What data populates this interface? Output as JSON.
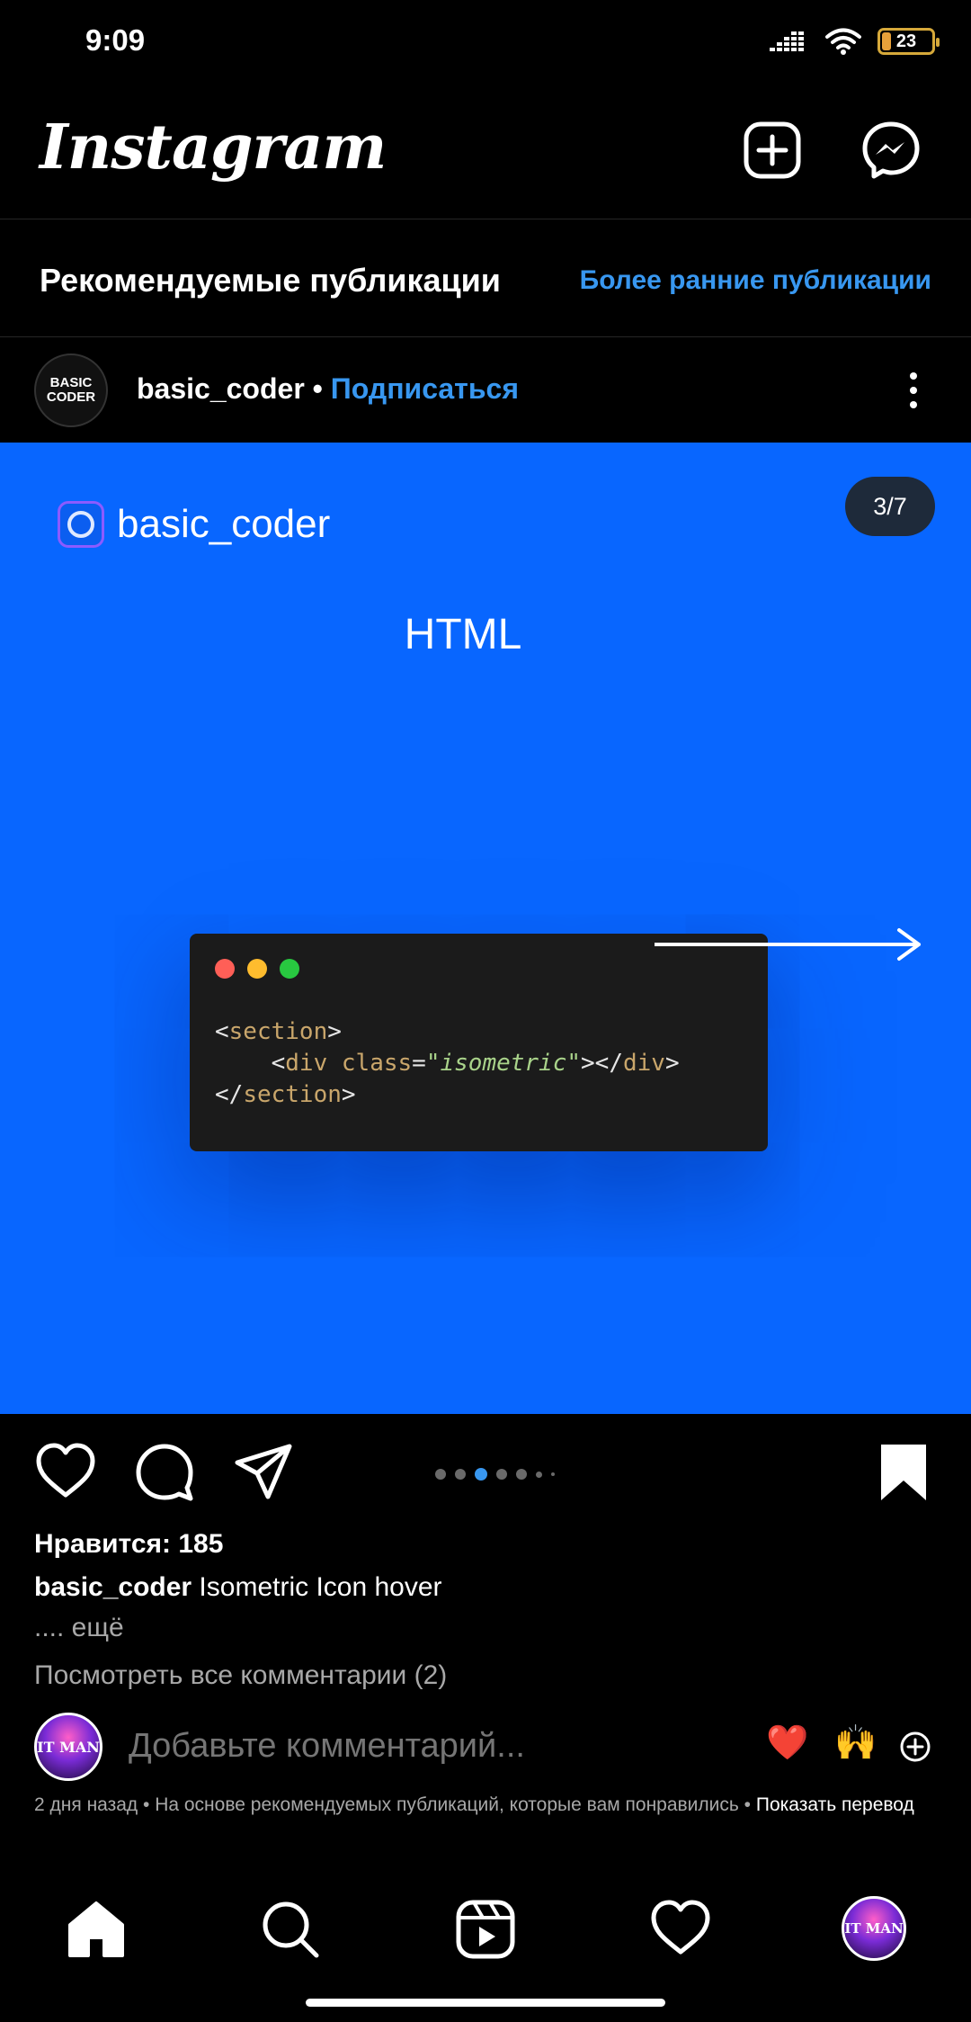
{
  "status_bar": {
    "time": "9:09",
    "battery": "23"
  },
  "header": {
    "logo": "Instagram",
    "icons": [
      "new-post-icon",
      "messenger-icon"
    ]
  },
  "section": {
    "title": "Рекомендуемые публикации",
    "link": "Более ранние публикации"
  },
  "post": {
    "username": "basic_coder",
    "separator": "•",
    "follow_label": "Подписаться",
    "avatar_text": {
      "line1": "BASIC",
      "line2": "CODER"
    },
    "slide": {
      "brand": "basic_coder",
      "counter": "3/7",
      "title": "HTML",
      "code": {
        "line1_open": "<",
        "line1_tag": "section",
        "line1_close": ">",
        "line2_indent": "    ",
        "line2_open": "<",
        "line2_tag": "div",
        "line2_attr": " class",
        "line2_eq": "=",
        "line2_str": "\"isometric\"",
        "line2_mid": "></",
        "line2_tag2": "div",
        "line2_close": ">",
        "line3_open": "</",
        "line3_tag": "section",
        "line3_close": ">"
      },
      "dot_colors": [
        "#ff5f57",
        "#febc2e",
        "#28c840"
      ],
      "background": "#0866ff"
    },
    "pager": {
      "total": 7,
      "active_index": 2
    },
    "likes": "Нравится: 185",
    "caption_user": "basic_coder",
    "caption_text": " Isometric Icon hover",
    "caption_more": ".... ещё",
    "view_comments": "Посмотреть все комментарии (2)",
    "comment_placeholder": "Добавьте комментарий...",
    "comment_avatar_text": "IT MAN",
    "quick_emojis": [
      "❤️",
      "🙌"
    ],
    "meta": {
      "text": "2 дня назад • На основе рекомендуемых публикаций, которые вам понравились • ",
      "translate": "Показать перевод"
    }
  },
  "bottom_nav": {
    "items": [
      "home-icon",
      "search-icon",
      "reels-icon",
      "activity-icon",
      "profile-avatar"
    ],
    "avatar_text": "IT MAN"
  },
  "colors": {
    "accent": "#3897f0",
    "background": "#000000",
    "slide_blue": "#0866ff"
  }
}
